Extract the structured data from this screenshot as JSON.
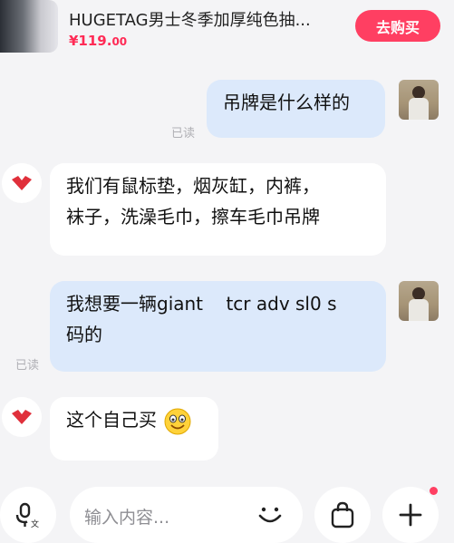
{
  "product": {
    "title": "HUGETAG男士冬季加厚纯色抽...",
    "price_main": "¥119.",
    "price_cents": "00",
    "buy_label": "去购买"
  },
  "messages": [
    {
      "from": "user",
      "text": "吊牌是什么样的",
      "status": "已读"
    },
    {
      "from": "shop",
      "lines": [
        "我们有鼠标垫，烟灰缸，内裤，",
        "袜子，洗澡毛巾，擦车毛巾吊牌"
      ]
    },
    {
      "from": "user",
      "lines": [
        "我想要一辆giant    tcr adv sl0 s",
        "码的"
      ],
      "status": "已读"
    },
    {
      "from": "shop",
      "text": "这个自己买",
      "emoji": "grinning-face"
    }
  ],
  "composer": {
    "placeholder": "输入内容..."
  },
  "colors": {
    "accent": "#ff3f62",
    "user_bubble": "#dce9fb",
    "shop_bubble": "#ffffff"
  },
  "icons": [
    "voice-to-text-icon",
    "emoji-smile-icon",
    "shopping-bag-icon",
    "plus-icon",
    "shop-logo-icon"
  ]
}
